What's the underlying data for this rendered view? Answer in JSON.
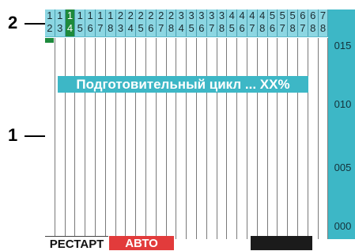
{
  "callouts": {
    "label_1": "1",
    "label_2": "2"
  },
  "header": {
    "active_index": 2,
    "columns": [
      [
        "1",
        "2"
      ],
      [
        "1",
        "3"
      ],
      [
        "1",
        "4"
      ],
      [
        "1",
        "5"
      ],
      [
        "1",
        "6"
      ],
      [
        "1",
        "7"
      ],
      [
        "1",
        "8"
      ],
      [
        "2",
        "3"
      ],
      [
        "2",
        "4"
      ],
      [
        "2",
        "5"
      ],
      [
        "2",
        "6"
      ],
      [
        "2",
        "7"
      ],
      [
        "2",
        "8"
      ],
      [
        "3",
        "4"
      ],
      [
        "3",
        "5"
      ],
      [
        "3",
        "6"
      ],
      [
        "3",
        "7"
      ],
      [
        "3",
        "8"
      ],
      [
        "4",
        "5"
      ],
      [
        "4",
        "6"
      ],
      [
        "4",
        "7"
      ],
      [
        "4",
        "8"
      ],
      [
        "5",
        "6"
      ],
      [
        "5",
        "7"
      ],
      [
        "5",
        "8"
      ],
      [
        "6",
        "7"
      ],
      [
        "6",
        "8"
      ],
      [
        "7",
        "8"
      ]
    ]
  },
  "axis": {
    "ticks": [
      "015",
      "010",
      "005",
      "000"
    ]
  },
  "status_text": "Подготовительный цикл ... XX%",
  "buttons": {
    "restart": "РЕСТАРТ",
    "auto": "АВТО"
  },
  "colors": {
    "header_bg": "#8cd6e2",
    "axis_bg": "#3db7c6",
    "active_cell": "#1e8a3c",
    "auto_button": "#e23b3b"
  }
}
